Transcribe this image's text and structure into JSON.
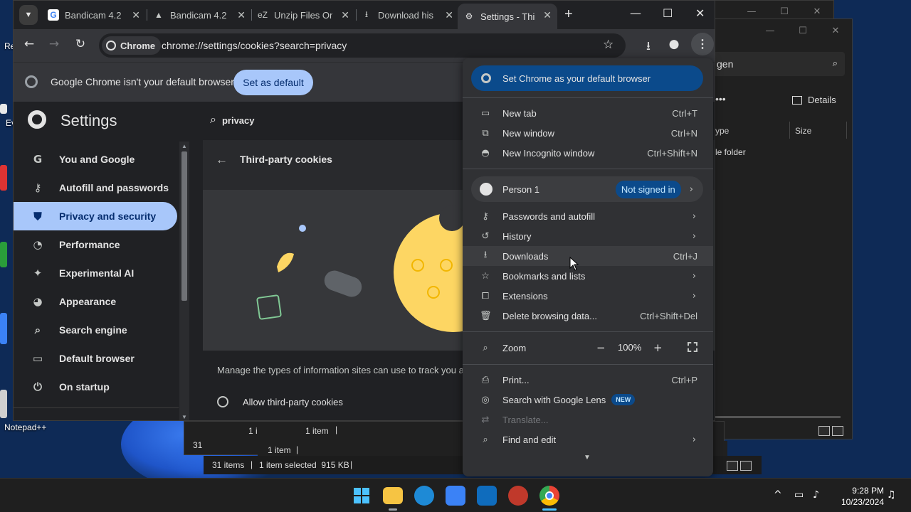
{
  "desktop": {
    "icon_labels": [
      "Re",
      "Ev",
      "Notepad++"
    ]
  },
  "browser": {
    "tabs": [
      {
        "title": "Bandicam 4.2",
        "favicon": "google-icon"
      },
      {
        "title": "Bandicam 4.2",
        "favicon": "cloud-icon"
      },
      {
        "title": "Unzip Files On",
        "favicon": "ez-icon"
      },
      {
        "title": "Download his",
        "favicon": "download-icon"
      },
      {
        "title": "Settings - Thi",
        "favicon": "gear-icon",
        "active": true
      }
    ],
    "chip_label": "Chrome",
    "url": "chrome://settings/cookies?search=privacy",
    "infobar": {
      "text": "Google Chrome isn't your default browser",
      "button": "Set as default"
    }
  },
  "settings": {
    "title": "Settings",
    "search_value": "privacy",
    "nav": [
      {
        "label": "You and Google",
        "icon": "google-g-icon"
      },
      {
        "label": "Autofill and passwords",
        "icon": "key-icon"
      },
      {
        "label": "Privacy and security",
        "icon": "shield-icon",
        "selected": true
      },
      {
        "label": "Performance",
        "icon": "gauge-icon"
      },
      {
        "label": "Experimental AI",
        "icon": "sparkle-icon"
      },
      {
        "label": "Appearance",
        "icon": "palette-icon"
      },
      {
        "label": "Search engine",
        "icon": "search-icon"
      },
      {
        "label": "Default browser",
        "icon": "browser-icon"
      },
      {
        "label": "On startup",
        "icon": "power-icon"
      }
    ],
    "page_title": "Third-party cookies",
    "description": "Manage the types of information sites can use to track you a",
    "option": "Allow third-party cookies"
  },
  "menu": {
    "default_banner": "Set Chrome as your default browser",
    "items_top": [
      {
        "label": "New tab",
        "shortcut": "Ctrl+T",
        "icon": "new-tab-icon"
      },
      {
        "label": "New window",
        "shortcut": "Ctrl+N",
        "icon": "new-window-icon"
      },
      {
        "label": "New Incognito window",
        "shortcut": "Ctrl+Shift+N",
        "icon": "incognito-icon"
      }
    ],
    "person": {
      "label": "Person 1",
      "badge": "Not signed in"
    },
    "items_mid": [
      {
        "label": "Passwords and autofill",
        "shortcut": "",
        "arrow": true,
        "icon": "key-icon"
      },
      {
        "label": "History",
        "shortcut": "",
        "arrow": true,
        "icon": "history-icon"
      },
      {
        "label": "Downloads",
        "shortcut": "Ctrl+J",
        "arrow": false,
        "icon": "download-icon"
      },
      {
        "label": "Bookmarks and lists",
        "shortcut": "",
        "arrow": true,
        "icon": "star-icon"
      },
      {
        "label": "Extensions",
        "shortcut": "",
        "arrow": true,
        "icon": "extension-icon"
      },
      {
        "label": "Delete browsing data...",
        "shortcut": "Ctrl+Shift+Del",
        "arrow": false,
        "icon": "trash-icon"
      }
    ],
    "zoom": {
      "label": "Zoom",
      "value": "100%"
    },
    "items_bottom": [
      {
        "label": "Print...",
        "shortcut": "Ctrl+P",
        "icon": "print-icon"
      },
      {
        "label": "Search with Google Lens",
        "badge": "NEW",
        "icon": "lens-icon"
      },
      {
        "label": "Translate...",
        "disabled": true,
        "icon": "translate-icon"
      },
      {
        "label": "Find and edit",
        "arrow": true,
        "icon": "find-icon"
      }
    ]
  },
  "explorer": {
    "search_fragment": "gen",
    "details_label": "Details",
    "col_type": "ype",
    "col_size": "Size",
    "row_fragment": "le folder",
    "status_a": "31 items",
    "status_b": "1 item selected  915 KB",
    "status_item_1": "1 item",
    "status_item_2": "1 item",
    "status_frag_1": "1 i",
    "status_frag_2": "31"
  },
  "taskbar": {
    "time": "9:28 PM",
    "date": "10/23/2024"
  }
}
